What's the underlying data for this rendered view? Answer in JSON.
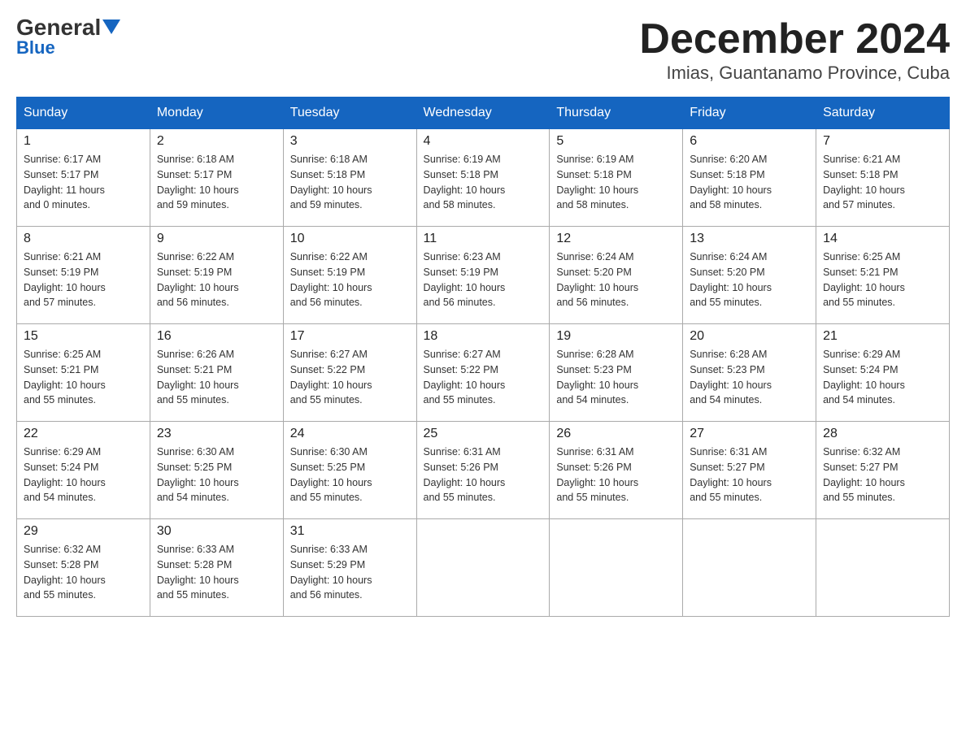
{
  "header": {
    "logo_line1": "General",
    "logo_line2": "Blue",
    "title": "December 2024",
    "subtitle": "Imias, Guantanamo Province, Cuba"
  },
  "weekdays": [
    "Sunday",
    "Monday",
    "Tuesday",
    "Wednesday",
    "Thursday",
    "Friday",
    "Saturday"
  ],
  "weeks": [
    [
      {
        "day": "1",
        "info": "Sunrise: 6:17 AM\nSunset: 5:17 PM\nDaylight: 11 hours\nand 0 minutes."
      },
      {
        "day": "2",
        "info": "Sunrise: 6:18 AM\nSunset: 5:17 PM\nDaylight: 10 hours\nand 59 minutes."
      },
      {
        "day": "3",
        "info": "Sunrise: 6:18 AM\nSunset: 5:18 PM\nDaylight: 10 hours\nand 59 minutes."
      },
      {
        "day": "4",
        "info": "Sunrise: 6:19 AM\nSunset: 5:18 PM\nDaylight: 10 hours\nand 58 minutes."
      },
      {
        "day": "5",
        "info": "Sunrise: 6:19 AM\nSunset: 5:18 PM\nDaylight: 10 hours\nand 58 minutes."
      },
      {
        "day": "6",
        "info": "Sunrise: 6:20 AM\nSunset: 5:18 PM\nDaylight: 10 hours\nand 58 minutes."
      },
      {
        "day": "7",
        "info": "Sunrise: 6:21 AM\nSunset: 5:18 PM\nDaylight: 10 hours\nand 57 minutes."
      }
    ],
    [
      {
        "day": "8",
        "info": "Sunrise: 6:21 AM\nSunset: 5:19 PM\nDaylight: 10 hours\nand 57 minutes."
      },
      {
        "day": "9",
        "info": "Sunrise: 6:22 AM\nSunset: 5:19 PM\nDaylight: 10 hours\nand 56 minutes."
      },
      {
        "day": "10",
        "info": "Sunrise: 6:22 AM\nSunset: 5:19 PM\nDaylight: 10 hours\nand 56 minutes."
      },
      {
        "day": "11",
        "info": "Sunrise: 6:23 AM\nSunset: 5:19 PM\nDaylight: 10 hours\nand 56 minutes."
      },
      {
        "day": "12",
        "info": "Sunrise: 6:24 AM\nSunset: 5:20 PM\nDaylight: 10 hours\nand 56 minutes."
      },
      {
        "day": "13",
        "info": "Sunrise: 6:24 AM\nSunset: 5:20 PM\nDaylight: 10 hours\nand 55 minutes."
      },
      {
        "day": "14",
        "info": "Sunrise: 6:25 AM\nSunset: 5:21 PM\nDaylight: 10 hours\nand 55 minutes."
      }
    ],
    [
      {
        "day": "15",
        "info": "Sunrise: 6:25 AM\nSunset: 5:21 PM\nDaylight: 10 hours\nand 55 minutes."
      },
      {
        "day": "16",
        "info": "Sunrise: 6:26 AM\nSunset: 5:21 PM\nDaylight: 10 hours\nand 55 minutes."
      },
      {
        "day": "17",
        "info": "Sunrise: 6:27 AM\nSunset: 5:22 PM\nDaylight: 10 hours\nand 55 minutes."
      },
      {
        "day": "18",
        "info": "Sunrise: 6:27 AM\nSunset: 5:22 PM\nDaylight: 10 hours\nand 55 minutes."
      },
      {
        "day": "19",
        "info": "Sunrise: 6:28 AM\nSunset: 5:23 PM\nDaylight: 10 hours\nand 54 minutes."
      },
      {
        "day": "20",
        "info": "Sunrise: 6:28 AM\nSunset: 5:23 PM\nDaylight: 10 hours\nand 54 minutes."
      },
      {
        "day": "21",
        "info": "Sunrise: 6:29 AM\nSunset: 5:24 PM\nDaylight: 10 hours\nand 54 minutes."
      }
    ],
    [
      {
        "day": "22",
        "info": "Sunrise: 6:29 AM\nSunset: 5:24 PM\nDaylight: 10 hours\nand 54 minutes."
      },
      {
        "day": "23",
        "info": "Sunrise: 6:30 AM\nSunset: 5:25 PM\nDaylight: 10 hours\nand 54 minutes."
      },
      {
        "day": "24",
        "info": "Sunrise: 6:30 AM\nSunset: 5:25 PM\nDaylight: 10 hours\nand 55 minutes."
      },
      {
        "day": "25",
        "info": "Sunrise: 6:31 AM\nSunset: 5:26 PM\nDaylight: 10 hours\nand 55 minutes."
      },
      {
        "day": "26",
        "info": "Sunrise: 6:31 AM\nSunset: 5:26 PM\nDaylight: 10 hours\nand 55 minutes."
      },
      {
        "day": "27",
        "info": "Sunrise: 6:31 AM\nSunset: 5:27 PM\nDaylight: 10 hours\nand 55 minutes."
      },
      {
        "day": "28",
        "info": "Sunrise: 6:32 AM\nSunset: 5:27 PM\nDaylight: 10 hours\nand 55 minutes."
      }
    ],
    [
      {
        "day": "29",
        "info": "Sunrise: 6:32 AM\nSunset: 5:28 PM\nDaylight: 10 hours\nand 55 minutes."
      },
      {
        "day": "30",
        "info": "Sunrise: 6:33 AM\nSunset: 5:28 PM\nDaylight: 10 hours\nand 55 minutes."
      },
      {
        "day": "31",
        "info": "Sunrise: 6:33 AM\nSunset: 5:29 PM\nDaylight: 10 hours\nand 56 minutes."
      },
      null,
      null,
      null,
      null
    ]
  ]
}
